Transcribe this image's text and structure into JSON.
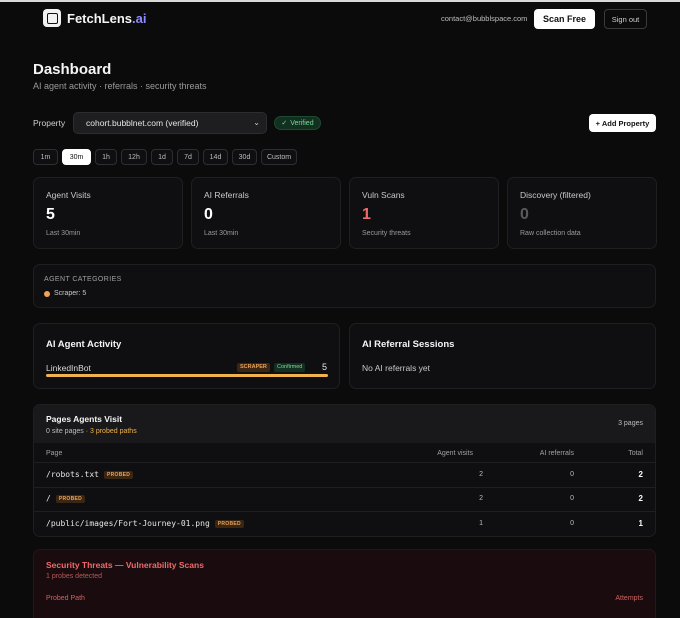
{
  "header": {
    "brand_main": "FetchLens",
    "brand_accent": ".ai",
    "email": "contact@bubblspace.com",
    "scan_label": "Scan Free",
    "signout_label": "Sign out"
  },
  "page": {
    "title": "Dashboard",
    "subtitle": "AI agent activity · referrals · security threats"
  },
  "property": {
    "label": "Property",
    "selected": "cohort.bubblnet.com (verified)",
    "verified_label": "Verified",
    "add_label": "+ Add Property"
  },
  "ranges": [
    {
      "label": "1m",
      "active": false
    },
    {
      "label": "30m",
      "active": true
    },
    {
      "label": "1h",
      "active": false
    },
    {
      "label": "12h",
      "active": false
    },
    {
      "label": "1d",
      "active": false
    },
    {
      "label": "7d",
      "active": false
    },
    {
      "label": "14d",
      "active": false
    },
    {
      "label": "30d",
      "active": false
    },
    {
      "label": "Custom",
      "active": false
    }
  ],
  "stats": [
    {
      "label": "Agent Visits",
      "value": "5",
      "sub": "Last 30min",
      "color": "#ffffff"
    },
    {
      "label": "AI Referrals",
      "value": "0",
      "sub": "Last 30min",
      "color": "#ffffff"
    },
    {
      "label": "Vuln Scans",
      "value": "1",
      "sub": "Security threats",
      "color": "#ef6b6b"
    },
    {
      "label": "Discovery (filtered)",
      "value": "0",
      "sub": "Raw collection data",
      "color": "#5a5a5a"
    }
  ],
  "categories": {
    "title": "AGENT CATEGORIES",
    "items": [
      {
        "label": "Scraper: 5",
        "color": "#f0a454"
      }
    ]
  },
  "agent_activity": {
    "title": "AI Agent Activity",
    "agents": [
      {
        "name": "LinkedInBot",
        "category": "SCRAPER",
        "status": "Confirmed",
        "count": "5",
        "share": 1.0
      }
    ]
  },
  "referrals": {
    "title": "AI Referral Sessions",
    "empty": "No AI referrals yet"
  },
  "pages_table": {
    "title": "Pages Agents Visit",
    "sub_site": "0 site pages",
    "sub_sep": "·",
    "sub_probed": "3 probed paths",
    "count": "3 pages",
    "columns": [
      "Page",
      "Agent visits",
      "AI referrals",
      "Total"
    ],
    "rows": [
      {
        "path": "/robots.txt",
        "badge": "PROBED",
        "visits": "2",
        "referrals": "0",
        "total": "2"
      },
      {
        "path": "/",
        "badge": "PROBED",
        "visits": "2",
        "referrals": "0",
        "total": "2"
      },
      {
        "path": "/public/images/Fort-Journey-01.png",
        "badge": "PROBED",
        "visits": "1",
        "referrals": "0",
        "total": "1"
      }
    ]
  },
  "security": {
    "title": "Security Threats — Vulnerability Scans",
    "sub": "1 probes detected",
    "col_path": "Probed Path",
    "col_attempts": "Attempts"
  }
}
